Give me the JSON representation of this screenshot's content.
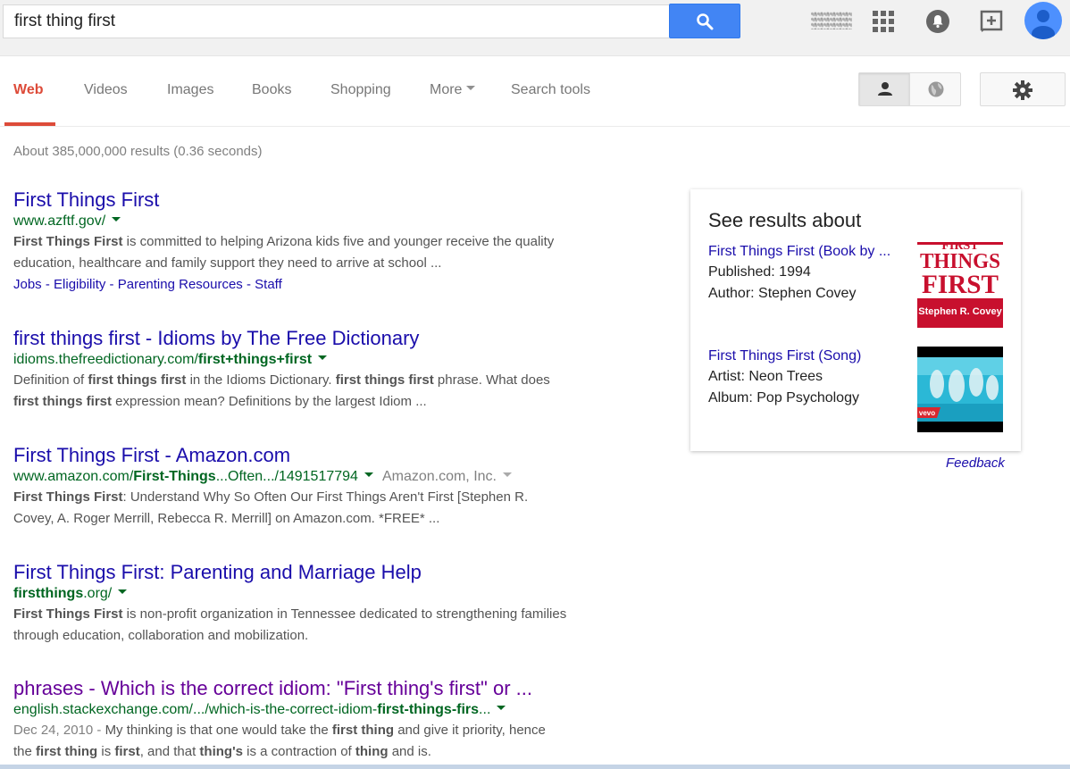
{
  "search": {
    "query": "first thing first"
  },
  "nav": {
    "tabs": [
      "Web",
      "Videos",
      "Images",
      "Books",
      "Shopping",
      "More",
      "Search tools"
    ]
  },
  "stats": "About 385,000,000 results (0.36 seconds)",
  "results": [
    {
      "title": "First Things First",
      "url": "www.azftf.gov/",
      "snippet_bold": "First Things First",
      "snippet_line1": " is committed to helping Arizona kids five and younger receive the quality",
      "snippet_line2": "education, healthcare and family support they need to arrive at school ...",
      "sitelinks": [
        "Jobs",
        "Eligibility",
        "Parenting Resources",
        "Staff"
      ]
    },
    {
      "title": "first things first - Idioms by The Free Dictionary",
      "url_prefix": "idioms.thefreedictionary.com/",
      "url_bold": "first+things+first",
      "s1": "Definition of ",
      "s1b": "first things first",
      "s2": " in the Idioms Dictionary. ",
      "s2b": "first things first",
      "s3": " phrase. What does",
      "s4b": "first things first",
      "s4": " expression mean? Definitions by the largest Idiom ..."
    },
    {
      "title": "First Things First - Amazon.com",
      "url_prefix": "www.amazon.com/",
      "url_bold": "First-Things",
      "url_suffix": "...Often.../1491517794",
      "cite": "Amazon.com, Inc.",
      "s1b": "First Things First",
      "s1": ": Understand Why So Often Our First Things Aren't First [Stephen R.",
      "s2": "Covey, A. Roger Merrill, Rebecca R. Merrill] on Amazon.com. *FREE* ..."
    },
    {
      "title": "First Things First: Parenting and Marriage Help",
      "url_bold": "firstthings",
      "url_suffix": ".org/",
      "s1b": "First Things First",
      "s1": " is non-profit organization in Tennessee dedicated to strengthening families",
      "s2": "through education, collaboration and mobilization."
    },
    {
      "title": "phrases - Which is the correct idiom: \"First thing's first\" or ...",
      "url_prefix": "english.stackexchange.com/.../which-is-the-correct-idiom-",
      "url_bold": "first-things-firs",
      "url_suffix": "...",
      "date": "Dec 24, 2010 - ",
      "s1": "My thinking is that one would take the ",
      "s1b": "first thing",
      "s1c": " and give it priority, hence",
      "s2a": "the ",
      "s2b": "first thing",
      "s2c": " is ",
      "s2d": "first",
      "s2e": ", and that ",
      "s2f": "thing's",
      "s2g": " is a contraction of ",
      "s2h": "thing",
      "s2i": " and is."
    }
  ],
  "knowledge_panel": {
    "title": "See results about",
    "items": [
      {
        "link": "First Things First (Book by ...",
        "line1": "Published: 1994",
        "line2": "Author: Stephen Covey",
        "image_top": "FIRST",
        "image_mid": "THINGS",
        "image_big": "FIRST",
        "image_author": "Stephen R. Covey"
      },
      {
        "link": "First Things First (Song)",
        "line1": "Artist: Neon Trees",
        "line2": "Album: Pop Psychology",
        "image_badge": "vevo"
      }
    ]
  },
  "feedback": "Feedback",
  "colors": {
    "link": "#1a0dab",
    "visited": "#660099",
    "url_green": "#006621",
    "accent_red": "#dd4b39",
    "search_blue": "#4285f4"
  },
  "icons": [
    "search-icon",
    "apps-grid-icon",
    "notifications-bell-icon",
    "share-plus-icon",
    "account-avatar-icon",
    "person-icon",
    "globe-icon",
    "gear-icon"
  ]
}
